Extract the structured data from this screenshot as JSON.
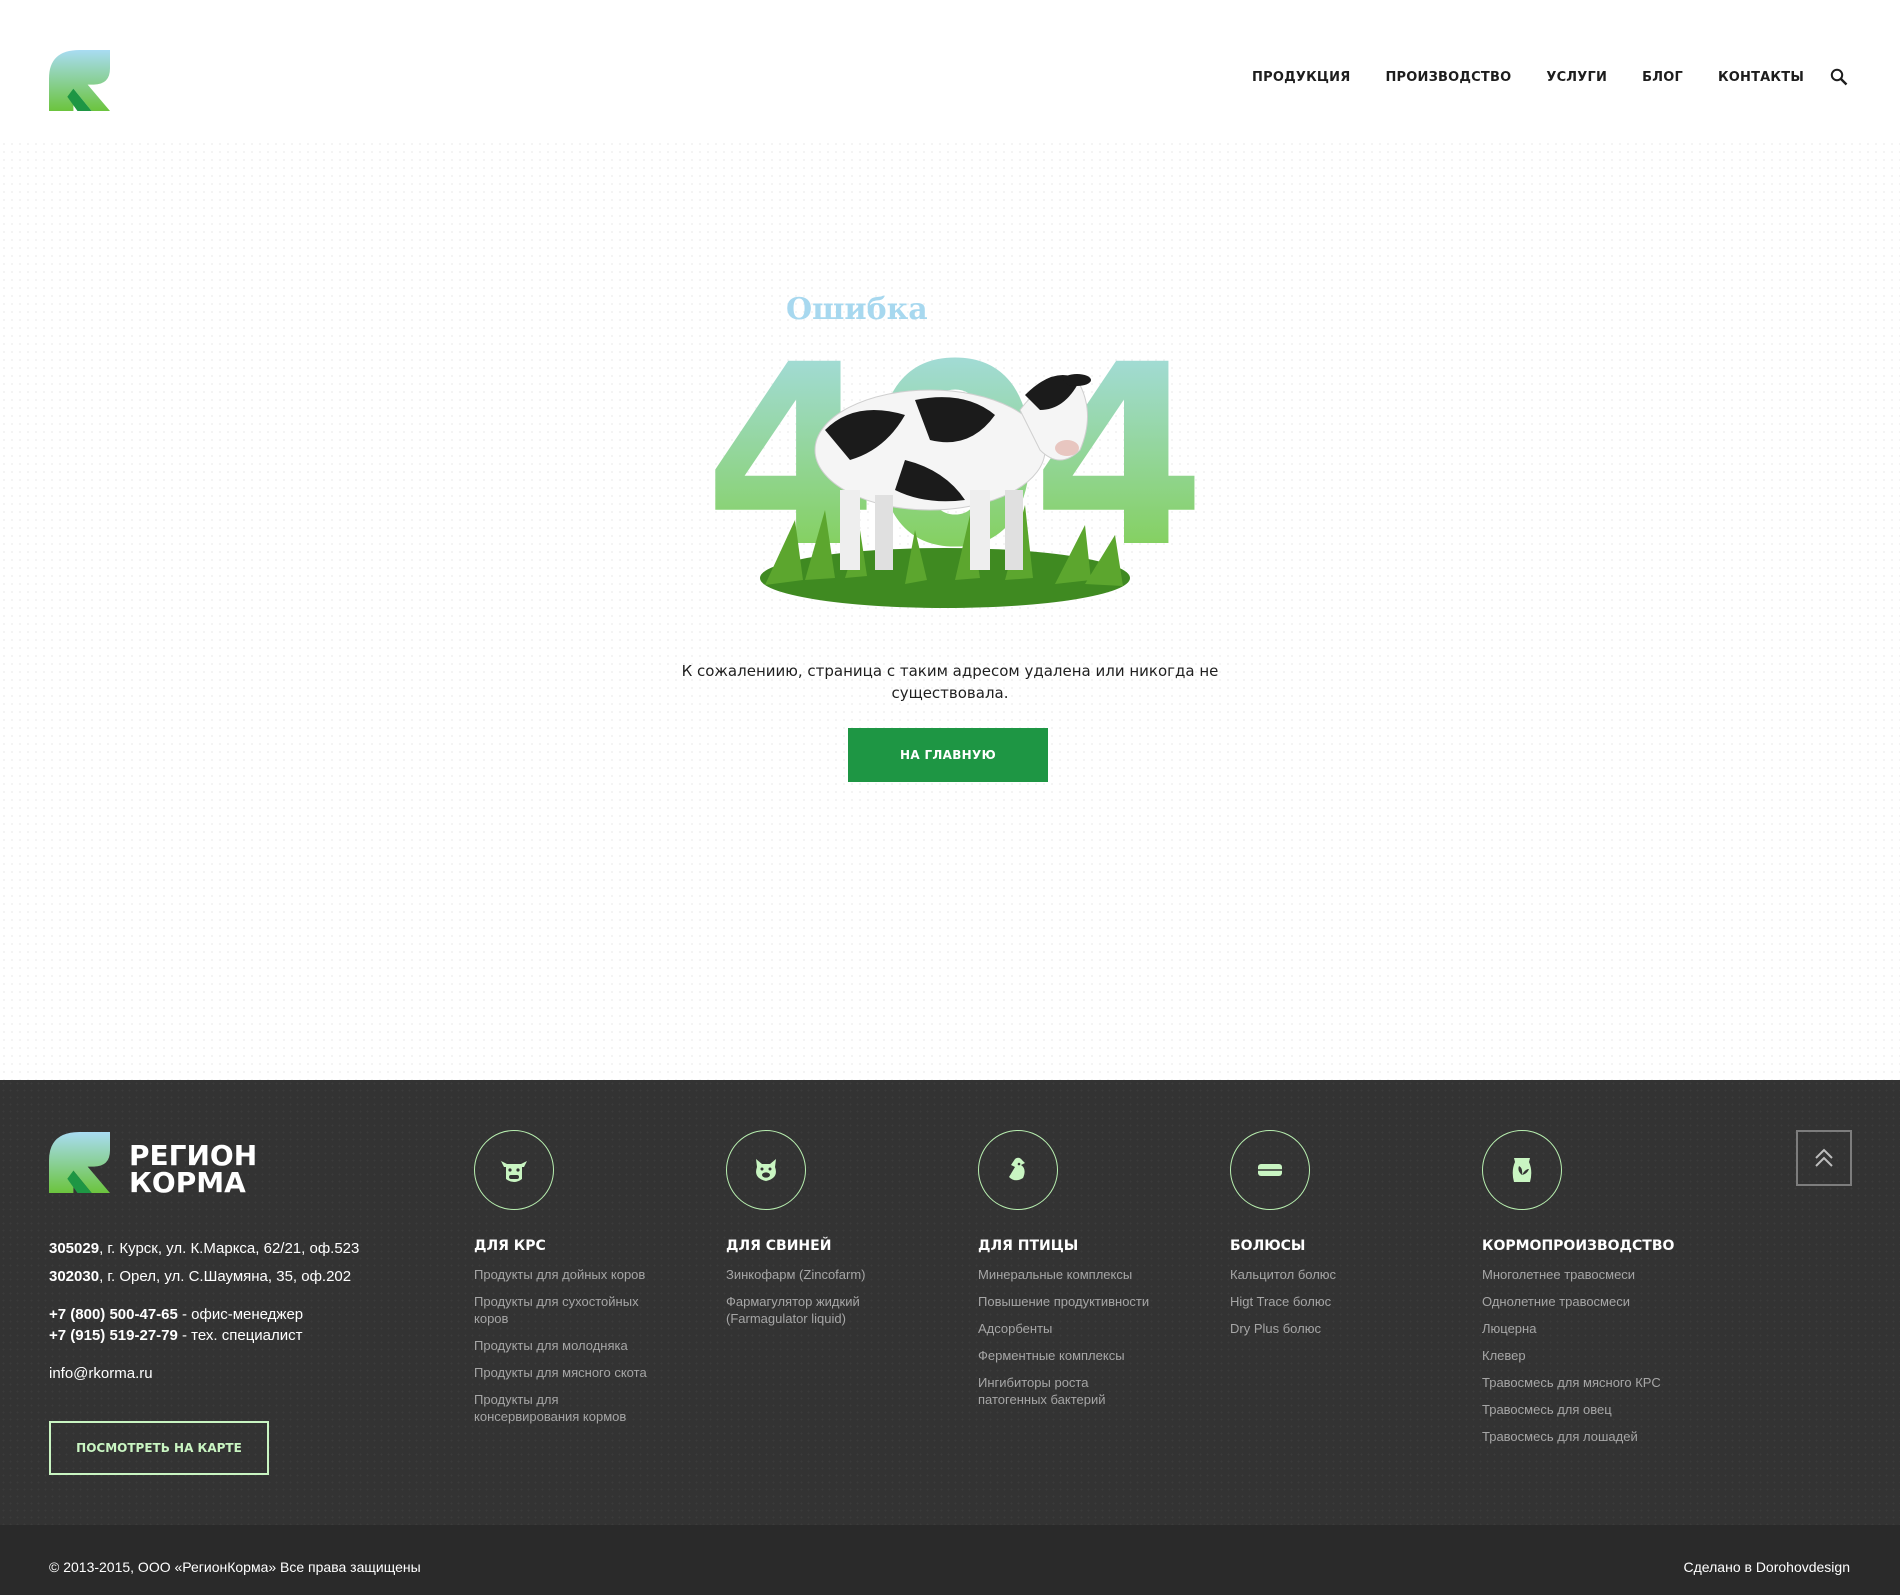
{
  "header": {
    "nav": [
      "ПРОДУКЦИЯ",
      "ПРОИЗВОДСТВО",
      "УСЛУГИ",
      "БЛОГ",
      "КОНТАКТЫ"
    ]
  },
  "error": {
    "word": "Ошибка",
    "code": "404",
    "message": "К сожалениию, страница с таким адресом удалена или никогда не существовала.",
    "button": "НА ГЛАВНУЮ"
  },
  "footer": {
    "brand_line1": "РЕГИОН",
    "brand_line2": "КОРМА",
    "address1_code": "305029",
    "address1_text": ", г. Курск, ул. К.Маркса, 62/21, оф.523",
    "address2_code": "302030",
    "address2_text": ", г. Орел, ул. С.Шаумяна, 35, оф.202",
    "phone1": "+7 (800) 500-47-65",
    "phone1_note": " - офис-менеджер",
    "phone2": "+7 (915) 519-27-79",
    "phone2_note": " - тех. специалист",
    "email": "info@rkorma.ru",
    "map_button": "ПОСМОТРЕТЬ НА КАРТЕ",
    "columns": [
      {
        "title": "ДЛЯ КРС",
        "icon": "cow-icon",
        "links": [
          "Продукты для дойных коров",
          "Продукты для сухостойных коров",
          "Продукты для молодняка",
          "Продукты для мясного скота",
          "Продукты для консервирования кормов"
        ]
      },
      {
        "title": "ДЛЯ СВИНЕЙ",
        "icon": "pig-icon",
        "links": [
          "Зинкофарм (Zincofarm)",
          "Фармагулятор жидкий (Farmagulator liquid)"
        ]
      },
      {
        "title": "ДЛЯ ПТИЦЫ",
        "icon": "chicken-icon",
        "links": [
          "Минеральные комплексы",
          "Повышение продуктивности",
          "Адсорбенты",
          "Ферментные комплексы",
          "Ингибиторы роста патогенных бактерий"
        ]
      },
      {
        "title": "БОЛЮСЫ",
        "icon": "bolus-icon",
        "links": [
          "Кальцитол болюс",
          "Higt Trace болюс",
          "Dry Plus болюс"
        ]
      },
      {
        "title": "КОРМОПРОИЗВОДСТВО",
        "icon": "feed-bag-icon",
        "links": [
          "Многолетнее травосмеси",
          "Однолетние травосмеси",
          "Люцерна",
          "Клевер",
          "Травосмесь для мясного КРС",
          "Травосмесь для овец",
          "Травосмесь для лошадей"
        ]
      }
    ],
    "copyright": "© 2013-2015, ООО «РегионКорма»  Все права защищены",
    "credit": "Сделано в Dorohovdesign"
  },
  "colors": {
    "accent": "#1e9644",
    "footer_bg": "#333333",
    "footer_accent": "#b8efb0"
  }
}
